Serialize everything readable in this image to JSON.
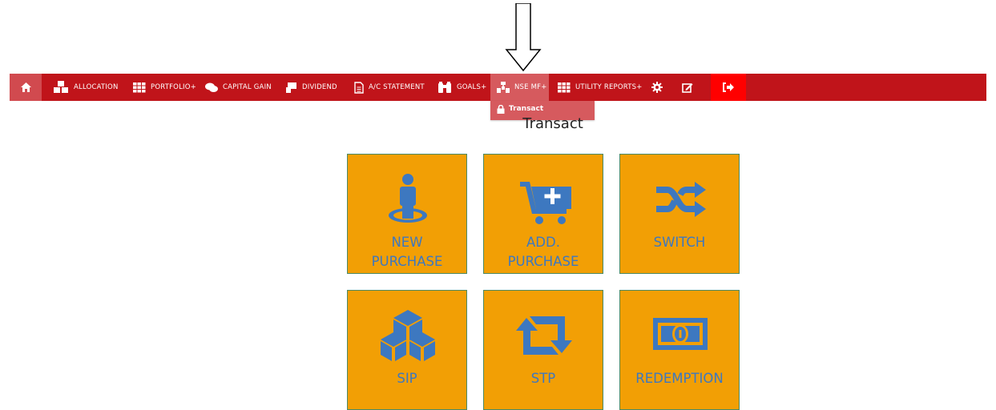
{
  "nav": {
    "home_icon": "home-icon",
    "items": [
      {
        "label": "ALLOCATION",
        "icon": "cubes-icon"
      },
      {
        "label": "PORTFOLIO+",
        "icon": "grid-icon"
      },
      {
        "label": "CAPITAL GAIN",
        "icon": "comments-icon"
      },
      {
        "label": "DIVIDEND",
        "icon": "money-hand-icon"
      },
      {
        "label": "A/C STATEMENT",
        "icon": "file-icon"
      },
      {
        "label": "GOALS+",
        "icon": "binoculars-icon"
      },
      {
        "label": "NSE MF+",
        "icon": "sitemap-icon"
      },
      {
        "label": "UTILITY REPORTS+",
        "icon": "grid-icon"
      }
    ],
    "settings_icon": "gear-icon",
    "edit_icon": "edit-icon",
    "logout_icon": "sign-out-icon",
    "colors": {
      "bar": "#c0141a",
      "active": "#d65a5e",
      "logout": "#ff0000"
    }
  },
  "dropdown": {
    "items": [
      {
        "label": "Transact",
        "icon": "lock-icon"
      }
    ]
  },
  "page": {
    "title": "Transact"
  },
  "tiles": [
    {
      "label": "NEW\nPURCHASE",
      "icon": "person-icon"
    },
    {
      "label": "ADD.\nPURCHASE",
      "icon": "cart-plus-icon"
    },
    {
      "label": "SWITCH",
      "icon": "shuffle-icon"
    },
    {
      "label": "SIP",
      "icon": "cubes-icon"
    },
    {
      "label": "STP",
      "icon": "retweet-icon"
    },
    {
      "label": "REDEMPTION",
      "icon": "money-icon"
    }
  ],
  "tile_colors": {
    "background": "#f29f05",
    "icon": "#3d78c0",
    "border": "#4b8a65"
  }
}
